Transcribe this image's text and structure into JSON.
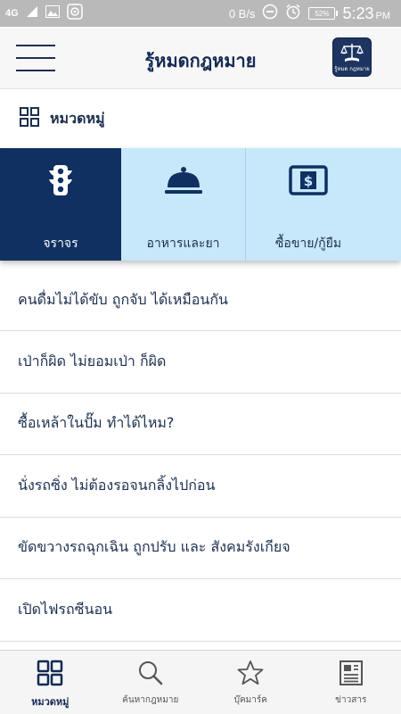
{
  "status_bar": {
    "network": "4G",
    "speed": "0 B/s",
    "battery": "52%",
    "time": "5:23",
    "ampm": "PM"
  },
  "header": {
    "title": "รู้หมดกฎหมาย",
    "logo_text": "รู้หมด กฎหมาย"
  },
  "category": {
    "title": "หมวดหมู่",
    "cards": [
      {
        "label": "จราจร",
        "icon": "traffic-light-icon",
        "selected": true
      },
      {
        "label": "อาหารและยา",
        "icon": "food-cloche-icon",
        "selected": false
      },
      {
        "label": "ซื้อขาย/กู้ยืม",
        "icon": "money-icon",
        "selected": false
      }
    ]
  },
  "articles": [
    {
      "title": "คนดื่มไม่ได้ขับ ถูกจับ ได้เหมือนกัน"
    },
    {
      "title": "เป่าก็ผิด ไม่ยอมเป่า ก็ผิด"
    },
    {
      "title": "ซื้อเหล้าในปั๊ม ทำได้ไหม?"
    },
    {
      "title": "นั่งรถซิ่ง ไม่ต้องรอจนกลิ้งไปก่อน"
    },
    {
      "title": "ขัดขวางรถฉุกเฉิน ถูกปรับ และ สังคมรังเกียจ"
    },
    {
      "title": "เปิดไฟรถซีนอน"
    }
  ],
  "bottom_nav": [
    {
      "label": "หมวดหมู่",
      "icon": "grid-icon",
      "active": true
    },
    {
      "label": "ค้นหากฎหมาย",
      "icon": "search-icon",
      "active": false
    },
    {
      "label": "บุ๊คมาร์ค",
      "icon": "star-icon",
      "active": false
    },
    {
      "label": "ข่าวสาร",
      "icon": "news-icon",
      "active": false
    }
  ],
  "colors": {
    "primary_navy": "#0f3061",
    "card_background": "#c6e8fa",
    "status_bar": "#b9b9b9"
  }
}
